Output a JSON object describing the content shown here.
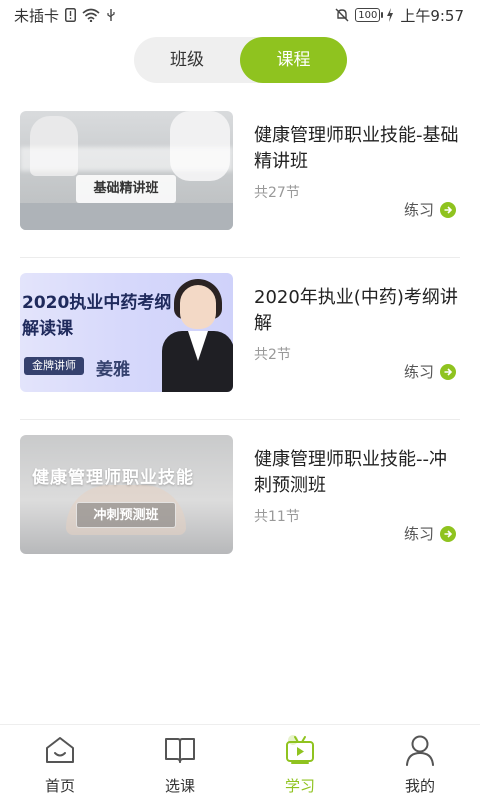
{
  "status_bar": {
    "carrier": "未插卡",
    "battery": "100",
    "time": "上午9:57"
  },
  "segment": {
    "items": [
      "班级",
      "课程"
    ],
    "selected": "课程"
  },
  "courses": [
    {
      "title": "健康管理师职业技能-基础精讲班",
      "count": "共27节",
      "action": "练习",
      "thumb_label": "基础精讲班"
    },
    {
      "title": "2020年执业(中药)考纲讲解",
      "count": "共2节",
      "action": "练习",
      "thumb_title": "2020执业中药考纲解读课",
      "thumb_badge": "金牌讲师",
      "thumb_teacher": "姜雅"
    },
    {
      "title": "健康管理师职业技能--冲刺预测班",
      "count": "共11节",
      "action": "练习",
      "thumb_title": "健康管理师职业技能",
      "thumb_sub": "冲刺预测班"
    }
  ],
  "tabbar": {
    "items": [
      {
        "label": "首页",
        "icon": "home-icon"
      },
      {
        "label": "选课",
        "icon": "book-icon"
      },
      {
        "label": "学习",
        "icon": "tv-icon"
      },
      {
        "label": "我的",
        "icon": "user-icon"
      }
    ],
    "active": "学习"
  },
  "colors": {
    "accent": "#8fc31f",
    "segment_bg": "#efefef",
    "text_primary": "#222222",
    "text_secondary": "#999999"
  }
}
